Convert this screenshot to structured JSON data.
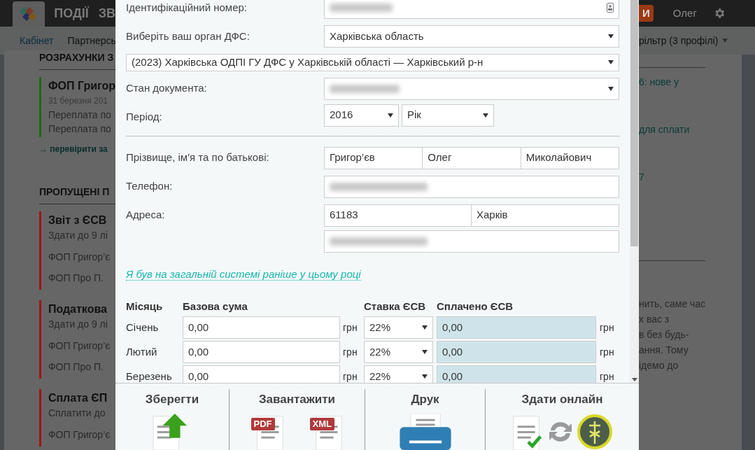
{
  "background": {
    "nav": {
      "tabs": [
        "ПОДІЇ",
        "ЗВ"
      ],
      "button": "И",
      "user": "Олег"
    },
    "subnav": {
      "items": [
        {
          "label": "Кабінет",
          "selected": true
        },
        {
          "label": "Партнерсь",
          "selected": false
        }
      ],
      "filter": "рільтр (3 профілі)"
    },
    "left": {
      "sections": [
        {
          "title": "РОЗРАХУНКИ З",
          "cards": [
            {
              "color": "#1f6b12",
              "title": "ФОП Григор",
              "lines": [
                "Переплата по",
                "Переплата по"
              ],
              "date": "31 березня 201"
            }
          ],
          "link": "→ перевірити за"
        },
        {
          "title": "ПРОПУЩЕНІ П",
          "cards": [
            {
              "color": "#a01414",
              "title": "Звіт з ЄСВ",
              "due": "Здати до 9 лі",
              "lines": [
                "ФОП Григор’є",
                "ФОП Про П."
              ]
            },
            {
              "color": "#a01414",
              "title": "Податкова",
              "due": "Здати до 9 лі",
              "lines": [
                "ФОП Григор’є",
                "ФОП Про П."
              ]
            },
            {
              "color": "#a01414",
              "title": "Сплата ЄП",
              "due": "Сплатити до",
              "lines": [
                "ФОП Григор’є"
              ]
            }
          ]
        }
      ]
    },
    "right": {
      "links": [
        "6: нове у",
        "для сплати",
        "7"
      ],
      "paragraph": [
        "нить, саме час",
        "х вас з",
        "в без будь-",
        "ання. Тому",
        "ідемо до"
      ]
    }
  },
  "form": {
    "id_field": {
      "label": "Ідентифікаційний номер:",
      "value_hidden": true
    },
    "tax_office": {
      "label": "Виберіть ваш орган ДФС:",
      "region": "Харківська область",
      "office": "(2023) Харківська ОДПІ ГУ ДФС у Харківській області — Харківський р-н"
    },
    "doc_state": {
      "label": "Стан документа:",
      "value_hidden": true
    },
    "period": {
      "label": "Період:",
      "year": "2016",
      "type": "Рік"
    },
    "name": {
      "label": "Прізвище, ім'я та по батькові:",
      "parts": [
        "Григор’єв",
        "Олег",
        "Миколайович"
      ]
    },
    "phone": {
      "label": "Телефон:",
      "value_hidden": true
    },
    "address": {
      "label": "Адреса:",
      "postcode": "61183",
      "city": "Харків",
      "street_hidden": true
    },
    "general_system_link": "Я був на загальній системі раніше у цьому році",
    "table": {
      "columns": [
        "Місяць",
        "Базова сума",
        "Ставка ЄСВ",
        "Сплачено ЄСВ"
      ],
      "rows": [
        {
          "month": "Січень",
          "base": "0,00",
          "base_unit": "грн",
          "rate": "22%",
          "paid": "0,00",
          "paid_unit": "грн"
        },
        {
          "month": "Лютий",
          "base": "0,00",
          "base_unit": "грн",
          "rate": "22%",
          "paid": "0,00",
          "paid_unit": "грн"
        },
        {
          "month": "Березень",
          "base": "0,00",
          "base_unit": "грн",
          "rate": "22%",
          "paid": "0,00",
          "paid_unit": "грн"
        }
      ]
    }
  },
  "actions": [
    {
      "kind": "save",
      "label": "Зберегти"
    },
    {
      "kind": "download",
      "label": "Завантажити",
      "badges": [
        "PDF",
        "XML"
      ]
    },
    {
      "kind": "print",
      "label": "Друк"
    },
    {
      "kind": "submit",
      "label": "Здати онлайн"
    }
  ]
}
